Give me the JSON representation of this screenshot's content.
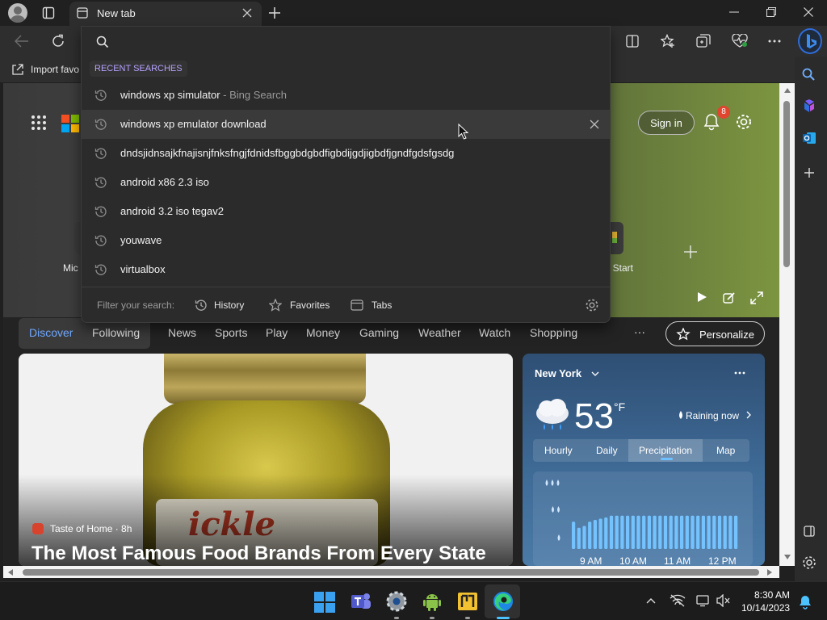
{
  "tab": {
    "title": "New tab"
  },
  "favorites_bar": {
    "import_label": "Import favo"
  },
  "search": {
    "placeholder": ""
  },
  "recent": {
    "header": "RECENT SEARCHES",
    "items": [
      {
        "text": "windows xp simulator",
        "source": " - Bing Search"
      },
      {
        "text": "windows xp emulator download",
        "source": ""
      },
      {
        "text": "dndsjidnsajkfnajisnjfnksfngjfdnidsfbggbdgbdfigbdijgdjigbdfjgndfgdsfgsdg",
        "source": ""
      },
      {
        "text": "android x86 2.3 iso",
        "source": ""
      },
      {
        "text": "android 3.2 iso tegav2",
        "source": ""
      },
      {
        "text": "youwave",
        "source": ""
      },
      {
        "text": "virtualbox",
        "source": ""
      }
    ]
  },
  "filter": {
    "label": "Filter your search:",
    "history": "History",
    "favorites": "Favorites",
    "tabs": "Tabs"
  },
  "header_right": {
    "sign_in": "Sign in",
    "notif_count": "8"
  },
  "quicklinks": {
    "left_label": "Mic",
    "right_label": "t Start"
  },
  "nav": {
    "discover": "Discover",
    "following": "Following",
    "items": [
      "News",
      "Sports",
      "Play",
      "Money",
      "Gaming",
      "Weather",
      "Watch",
      "Shopping"
    ],
    "more": "···",
    "personalize": "Personalize"
  },
  "article": {
    "source": "Taste of Home · 8h",
    "title": "The Most Famous Food Brands From Every State",
    "label_text": "ickle"
  },
  "weather": {
    "city": "New York",
    "temp": "53",
    "unit": "°F",
    "status": "Raining now",
    "tabs": [
      "Hourly",
      "Daily",
      "Precipitation",
      "Map"
    ],
    "times": [
      "9 AM",
      "10 AM",
      "11 AM",
      "12 PM"
    ],
    "precip_levels": [
      0.45,
      0.35,
      0.38,
      0.45,
      0.48,
      0.5,
      0.52,
      0.55,
      0.55,
      0.55,
      0.55,
      0.55,
      0.55,
      0.55,
      0.55,
      0.55,
      0.55,
      0.55,
      0.55,
      0.55,
      0.55,
      0.55,
      0.55,
      0.55,
      0.55,
      0.55,
      0.55,
      0.55,
      0.55,
      0.55,
      0.55
    ]
  },
  "clock": {
    "time": "8:30 AM",
    "date": "10/14/2023"
  },
  "colors": {
    "accent": "#2563eb",
    "bing_blue": "#1f6fd6"
  }
}
